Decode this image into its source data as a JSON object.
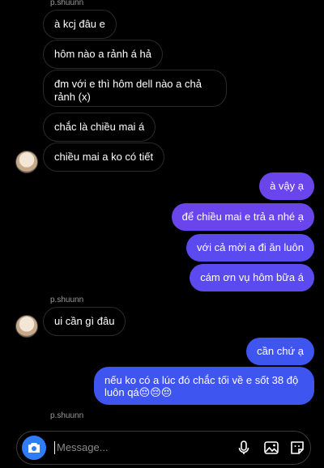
{
  "thread": {
    "sender_name": "p.shuunn",
    "incoming_1": [
      "à kcj đâu e",
      "hôm nào a rảnh á hả",
      "đm với e thì hôm dell nào a chả rảnh (x)",
      "chắc là chiều mai á",
      "chiều mai a ko có tiết"
    ],
    "outgoing_1": [
      "à vậy ạ",
      "để chiều mai e trả a nhé ạ",
      "với cả mời a đi ăn luôn",
      "cám ơn vụ hôm bữa á"
    ],
    "incoming_2": [
      "ui cần gì đâu"
    ],
    "outgoing_2": [
      "cần chứ ạ",
      "nếu ko có a lúc đó chắc tối về e sốt 38 độ luôn qá😔😔😔"
    ]
  },
  "composer": {
    "placeholder": "Message..."
  },
  "icons": [
    "camera-icon",
    "microphone-icon",
    "gallery-icon",
    "sticker-icon"
  ],
  "colors": {
    "outgoing_blue": "#3f55f0",
    "outgoing_purple": "#6a45ec",
    "camera_blue": "#2f7df6"
  }
}
